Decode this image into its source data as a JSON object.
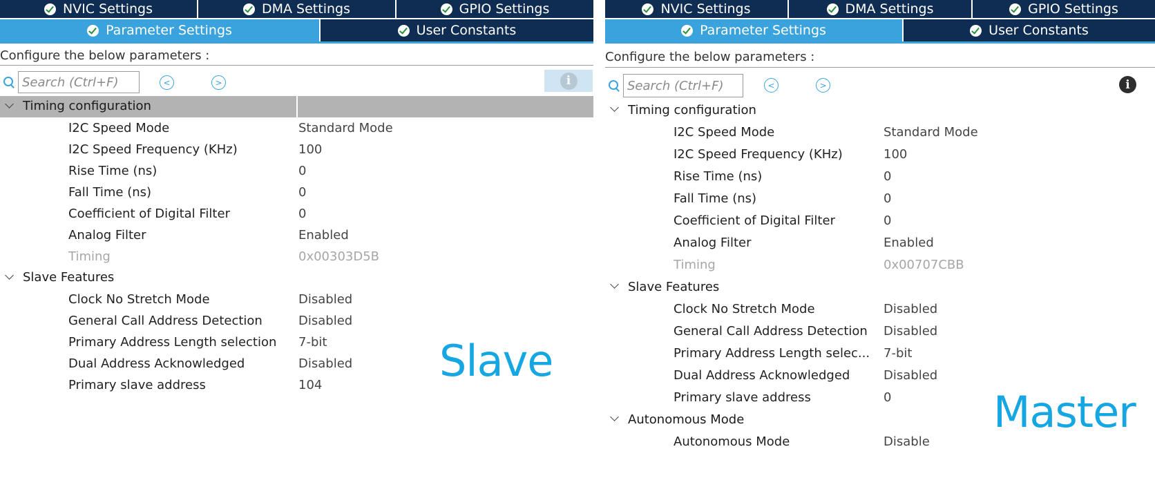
{
  "slave": {
    "tabs_top": [
      {
        "label": "NVIC Settings"
      },
      {
        "label": "DMA Settings"
      },
      {
        "label": "GPIO Settings"
      }
    ],
    "tabs_bottom": [
      {
        "label": "Parameter Settings"
      },
      {
        "label": "User Constants"
      }
    ],
    "configure_text": "Configure the below parameters :",
    "search_placeholder": "Search (Ctrl+F)",
    "groups": [
      {
        "label": "Timing configuration",
        "params": [
          {
            "name": "I2C Speed Mode",
            "value": "Standard Mode"
          },
          {
            "name": "I2C Speed Frequency (KHz)",
            "value": "100"
          },
          {
            "name": "Rise Time (ns)",
            "value": "0"
          },
          {
            "name": "Fall Time (ns)",
            "value": "0"
          },
          {
            "name": "Coefficient of Digital Filter",
            "value": "0"
          },
          {
            "name": "Analog Filter",
            "value": "Enabled"
          },
          {
            "name": "Timing",
            "value": "0x00303D5B"
          }
        ]
      },
      {
        "label": "Slave Features",
        "params": [
          {
            "name": "Clock No Stretch Mode",
            "value": "Disabled"
          },
          {
            "name": "General Call Address Detection",
            "value": "Disabled"
          },
          {
            "name": "Primary Address Length selection",
            "value": "7-bit"
          },
          {
            "name": "Dual Address Acknowledged",
            "value": "Disabled"
          },
          {
            "name": "Primary slave address",
            "value": "104"
          }
        ]
      }
    ],
    "watermark": "Slave"
  },
  "master": {
    "tabs_top": [
      {
        "label": "NVIC Settings"
      },
      {
        "label": "DMA Settings"
      },
      {
        "label": "GPIO Settings"
      }
    ],
    "tabs_bottom": [
      {
        "label": "Parameter Settings"
      },
      {
        "label": "User Constants"
      }
    ],
    "configure_text": "Configure the below parameters :",
    "search_placeholder": "Search (Ctrl+F)",
    "groups": [
      {
        "label": "Timing configuration",
        "params": [
          {
            "name": "I2C Speed Mode",
            "value": "Standard Mode"
          },
          {
            "name": "I2C Speed Frequency (KHz)",
            "value": "100"
          },
          {
            "name": "Rise Time (ns)",
            "value": "0"
          },
          {
            "name": "Fall Time (ns)",
            "value": "0"
          },
          {
            "name": "Coefficient of Digital Filter",
            "value": "0"
          },
          {
            "name": "Analog Filter",
            "value": "Enabled"
          },
          {
            "name": "Timing",
            "value": "0x00707CBB"
          }
        ]
      },
      {
        "label": "Slave Features",
        "params": [
          {
            "name": "Clock No Stretch Mode",
            "value": "Disabled"
          },
          {
            "name": "General Call Address Detection",
            "value": "Disabled"
          },
          {
            "name": "Primary Address Length selec...",
            "value": "7-bit"
          },
          {
            "name": "Dual Address Acknowledged",
            "value": "Disabled"
          },
          {
            "name": "Primary slave address",
            "value": "0"
          }
        ]
      },
      {
        "label": "Autonomous Mode",
        "params": [
          {
            "name": "Autonomous Mode",
            "value": "Disable"
          }
        ]
      }
    ],
    "watermark": "Master"
  },
  "colors": {
    "tab_dark": "#0f2c52",
    "tab_active": "#3aa3de",
    "selected_row": "#b3b3b3",
    "watermark": "#16a7e3",
    "disabled_text": "#a6a6a6"
  }
}
